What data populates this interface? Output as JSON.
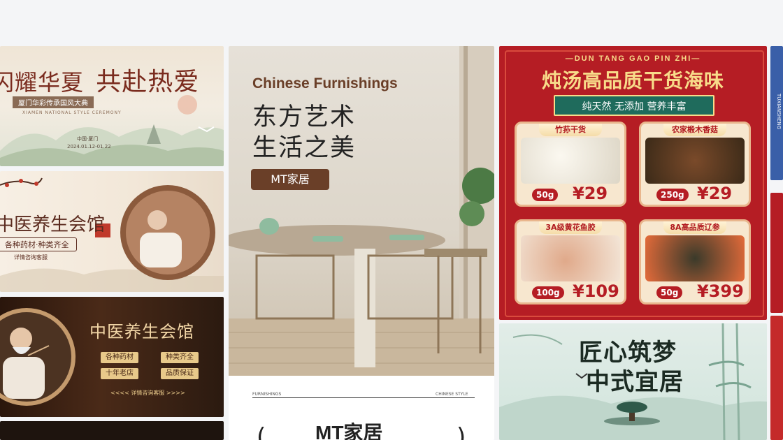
{
  "col1": {
    "banner1": {
      "title_a": "闪耀华夏",
      "title_b": "共赴热爱",
      "subtitle": "厦门华彩传承国风大典",
      "english": "XIAMEN NATIONAL STYLE CEREMONY",
      "location": "中国·厦门",
      "date": "2024.01.12-01.22"
    },
    "banner2": {
      "title": "中医养生会馆",
      "subtitle": "各种药材·种类齐全",
      "contact": "详情咨询客服"
    },
    "banner3": {
      "title": "中医养生会馆",
      "tags": [
        "各种药材",
        "种类齐全",
        "十年老店",
        "品质保证"
      ],
      "contact": "<<<< 详情咨询客服 >>>>"
    }
  },
  "col2": {
    "english_title": "Chinese Furnishings",
    "headline_1": "东方艺术",
    "headline_2": "生活之美",
    "brand_tag": "MT家居",
    "footer_left": "FURNISHINGS",
    "footer_right": "CHINESE STYLE",
    "footer_brand": "MT家居"
  },
  "col3": {
    "seafood": {
      "pinyin": "—DUN TANG GAO PIN ZHI—",
      "title": "炖汤高品质干货海味",
      "ribbon": "纯天然 无添加 营养丰富",
      "products": [
        {
          "name": "竹荪干货",
          "weight": "50g",
          "price": "¥29"
        },
        {
          "name": "农家椴木香菇",
          "weight": "250g",
          "price": "¥29"
        },
        {
          "name": "3A级黄花鱼胶",
          "weight": "100g",
          "price": "¥109"
        },
        {
          "name": "8A高品质辽参",
          "weight": "50g",
          "price": "¥399"
        }
      ]
    },
    "home": {
      "title_1": "匠心筑梦",
      "title_2": "中式宜居"
    }
  },
  "col4": {
    "vertical_text": "TUXIANSHENG"
  },
  "colors": {
    "accent_red": "#b51d24",
    "gold": "#f8dc8a",
    "brown": "#6a3f28"
  }
}
